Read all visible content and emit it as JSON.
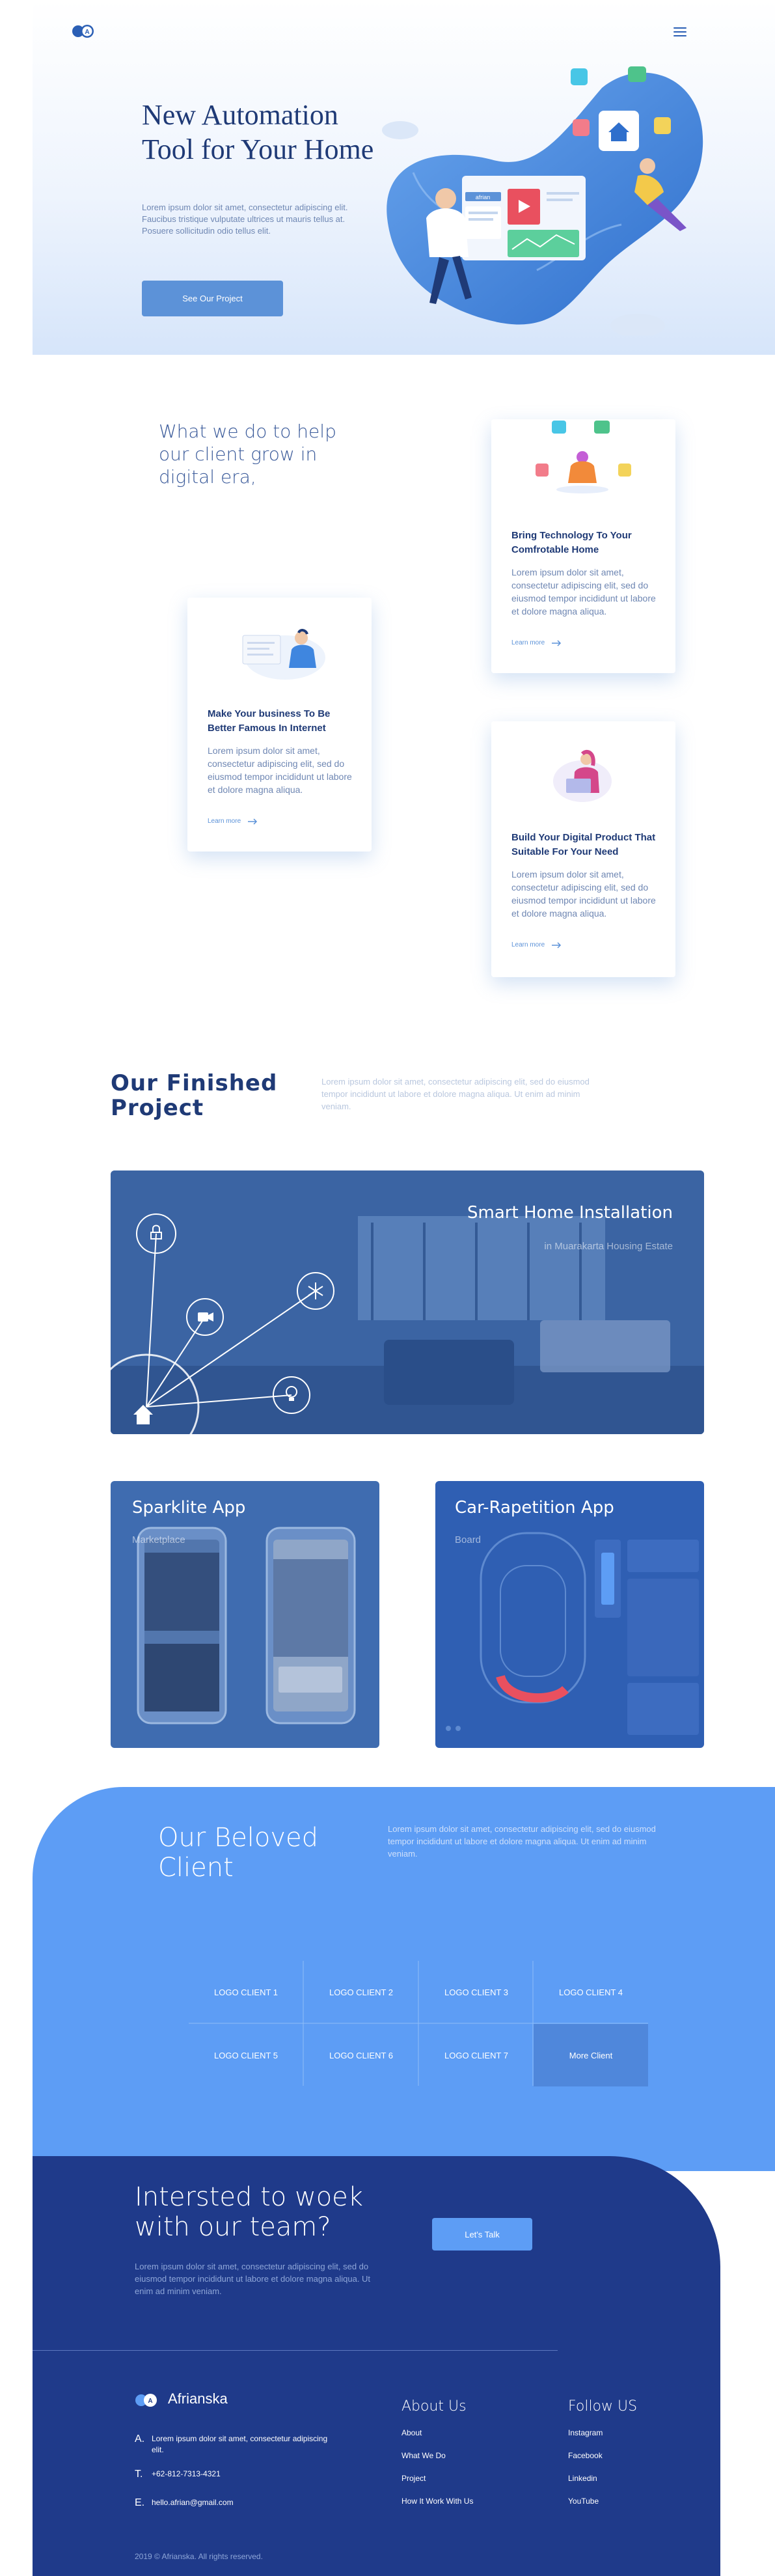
{
  "nav": {
    "menu_icon": "hamburger-icon",
    "logo_icon": "brand-logo-icon"
  },
  "hero": {
    "title_line1": "New Automation",
    "title_line2": "Tool for Your Home",
    "text": "Lorem ipsum dolor sit amet, consectetur adipiscing elit. Faucibus tristique vulputate ultrices ut mauris tellus at. Posuere sollicitudin odio tellus elit.",
    "cta": "See Our Project",
    "illustration_label": "afrian"
  },
  "services": {
    "title": "What we do to help our client grow in digital era,",
    "cards": [
      {
        "title": "Bring Technology To Your Comfrotable Home",
        "text": "Lorem ipsum dolor sit amet, consectetur adipiscing elit, sed do eiusmod tempor incididunt ut labore et dolore magna aliqua.",
        "link": "Learn more",
        "icon": "smart-home-icon"
      },
      {
        "title": "Make Your business To Be Better Famous In Internet",
        "text": "Lorem ipsum dolor sit amet, consectetur adipiscing elit, sed do eiusmod tempor incididunt ut labore et dolore magna aliqua.",
        "link": "Learn more",
        "icon": "presentation-icon"
      },
      {
        "title": "Build Your Digital Product That Suitable For Your Need",
        "text": "Lorem ipsum dolor sit amet, consectetur adipiscing elit, sed do eiusmod tempor incididunt ut labore et dolore magna aliqua.",
        "link": "Learn more",
        "icon": "laptop-user-icon"
      }
    ]
  },
  "projects": {
    "title": "Our Finished Project",
    "text": "Lorem ipsum dolor sit amet, consectetur adipiscing elit, sed do eiusmod tempor incididunt ut labore et dolore magna aliqua. Ut enim ad minim veniam.",
    "items": [
      {
        "title": "Smart Home Installation",
        "subtitle": "in Muarakarta Housing Estate"
      },
      {
        "title": "Sparklite App",
        "subtitle": "Marketplace"
      },
      {
        "title": "Car-Rapetition App",
        "subtitle": "Board"
      }
    ]
  },
  "clients": {
    "title": "Our Beloved Client",
    "text": "Lorem ipsum dolor sit amet, consectetur adipiscing elit, sed do eiusmod tempor incididunt ut labore et dolore magna aliqua. Ut enim ad minim veniam.",
    "logos": [
      "LOGO CLIENT 1",
      "LOGO CLIENT 2",
      "LOGO CLIENT 3",
      "LOGO CLIENT 4",
      "LOGO CLIENT 5",
      "LOGO CLIENT 6",
      "LOGO CLIENT 7",
      "More Client"
    ]
  },
  "cta": {
    "title": "Intersted to woek with our team?",
    "text": "Lorem ipsum dolor sit amet, consectetur adipiscing elit, sed do eiusmod tempor incididunt ut labore et dolore magna aliqua. Ut enim ad minim veniam.",
    "button": "Let's Talk"
  },
  "footer": {
    "brand": "Afrianska",
    "address_key": "A.",
    "address": "Lorem ipsum dolor sit amet, consectetur adipiscing elit.",
    "phone_key": "T.",
    "phone": "+62-812-7313-4321",
    "email_key": "E.",
    "email": "hello.afrian@gmail.com",
    "about_title": "About Us",
    "about_links": [
      "About",
      "What We Do",
      "Project",
      "How It Work With Us"
    ],
    "follow_title": "Follow US",
    "follow_links": [
      "Instagram",
      "Facebook",
      "Linkedin",
      "YouTube"
    ],
    "copyright": "2019 © Afrianska. All rights reserved."
  },
  "colors": {
    "primary": "#5c92d8",
    "navy": "#1f3a8a",
    "client_bg": "#5d9df5",
    "title": "#1f3a76"
  }
}
